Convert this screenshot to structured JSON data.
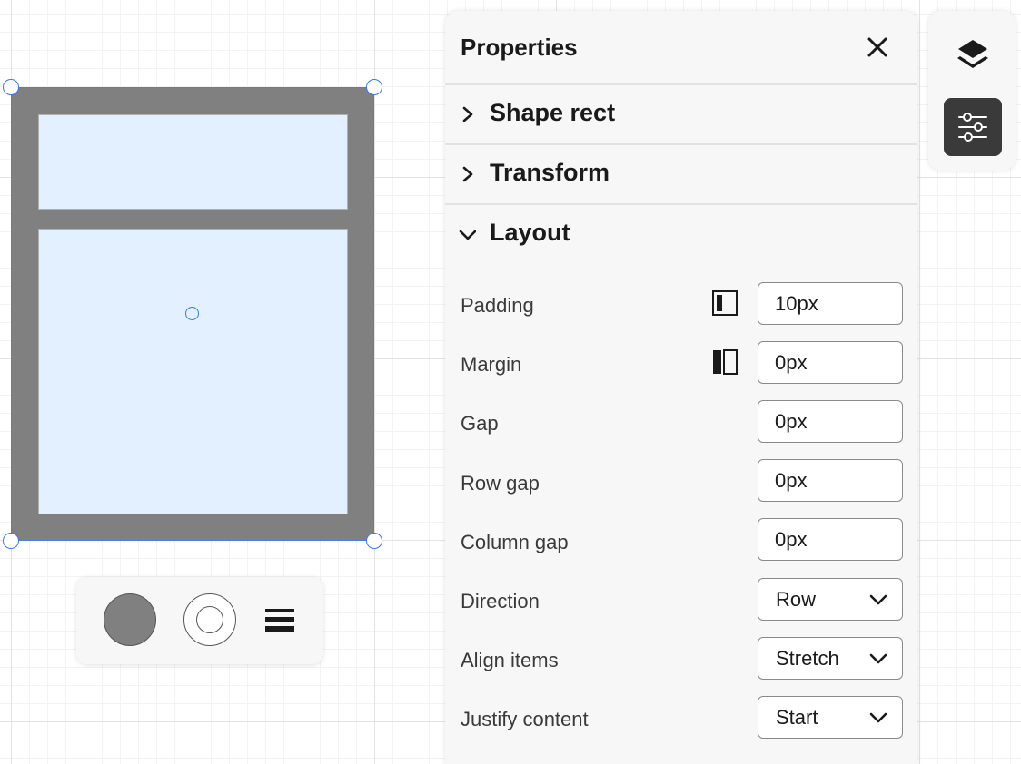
{
  "panel": {
    "title": "Properties",
    "sections": [
      {
        "label": "Shape rect",
        "expanded": false
      },
      {
        "label": "Transform",
        "expanded": false
      },
      {
        "label": "Layout",
        "expanded": true
      }
    ]
  },
  "layout": {
    "padding": {
      "label": "Padding",
      "value": "10px"
    },
    "margin": {
      "label": "Margin",
      "value": "0px"
    },
    "gap": {
      "label": "Gap",
      "value": "0px"
    },
    "row_gap": {
      "label": "Row gap",
      "value": "0px"
    },
    "column_gap": {
      "label": "Column gap",
      "value": "0px"
    },
    "direction": {
      "label": "Direction",
      "value": "Row"
    },
    "align_items": {
      "label": "Align items",
      "value": "Stretch"
    },
    "justify_content": {
      "label": "Justify content",
      "value": "Start"
    }
  },
  "toolbar": {
    "fill_color": "#808080",
    "stroke_icon": "stroke-circle-icon",
    "lines_icon": "stroke-width-icon"
  },
  "mini_toolbar": {
    "items": [
      {
        "icon": "layers-icon",
        "active": false
      },
      {
        "icon": "sliders-icon",
        "active": true
      }
    ]
  },
  "shape": {
    "fill": "#808080",
    "child_fill": "#e2f0ff",
    "selection_color": "#3b78e7"
  }
}
